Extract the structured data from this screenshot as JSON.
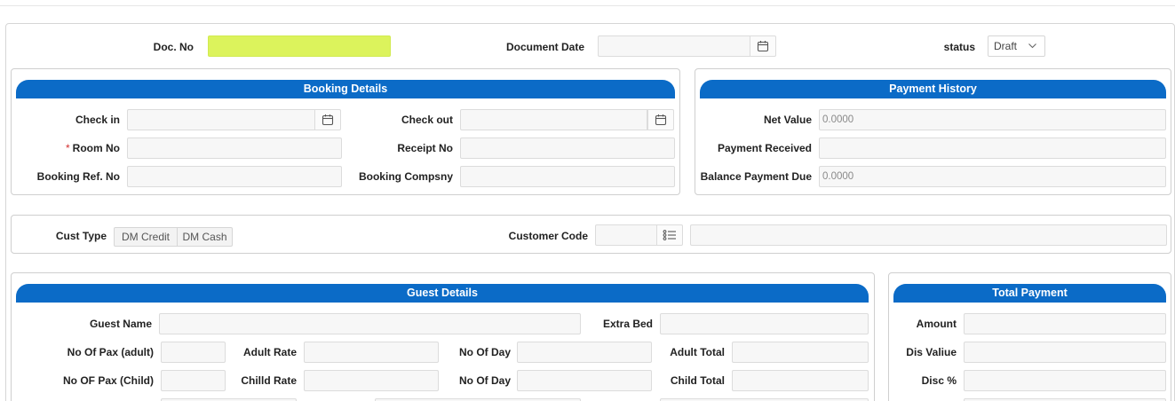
{
  "header": {
    "doc_no_label": "Doc. No",
    "doc_no_value": "",
    "document_date_label": "Document Date",
    "document_date_value": "",
    "status_label": "status",
    "status_value": "Draft"
  },
  "booking": {
    "title": "Booking Details",
    "check_in_label": "Check in",
    "check_out_label": "Check out",
    "room_no_required": "*",
    "room_no_label": "Room No",
    "receipt_no_label": "Receipt No",
    "booking_ref_label": "Booking Ref. No",
    "booking_company_label": "Booking Compsny"
  },
  "payment_history": {
    "title": "Payment History",
    "net_value_label": "Net Value",
    "net_value": "0.0000",
    "payment_received_label": "Payment Received",
    "payment_received": "",
    "balance_due_label": "Balance Payment Due",
    "balance_due": "0.0000"
  },
  "customer": {
    "cust_type_label": "Cust Type",
    "cust_type_options": [
      "DM Credit",
      "DM Cash"
    ],
    "customer_code_label": "Customer Code"
  },
  "guest": {
    "title": "Guest Details",
    "guest_name_label": "Guest Name",
    "extra_bed_label": "Extra Bed",
    "pax_adult_label": "No Of Pax (adult)",
    "adult_rate_label": "Adult Rate",
    "no_of_day_label_1": "No Of Day",
    "adult_total_label": "Adult Total",
    "pax_child_label": "No OF Pax (Child)",
    "child_rate_label": "Chilld Rate",
    "no_of_day_label_2": "No Of Day",
    "child_total_label": "Child Total"
  },
  "total_payment": {
    "title": "Total Payment",
    "amount_label": "Amount",
    "dis_value_label": "Dis Valiue",
    "disc_pct_label": "Disc %"
  },
  "icons": {
    "calendar": "calendar-icon",
    "chevron": "chevron-down-icon",
    "list": "list-icon"
  },
  "colors": {
    "panel_header": "#0b6bc7",
    "doc_no_highlight": "#dcf35c",
    "required": "#d32f2f"
  }
}
